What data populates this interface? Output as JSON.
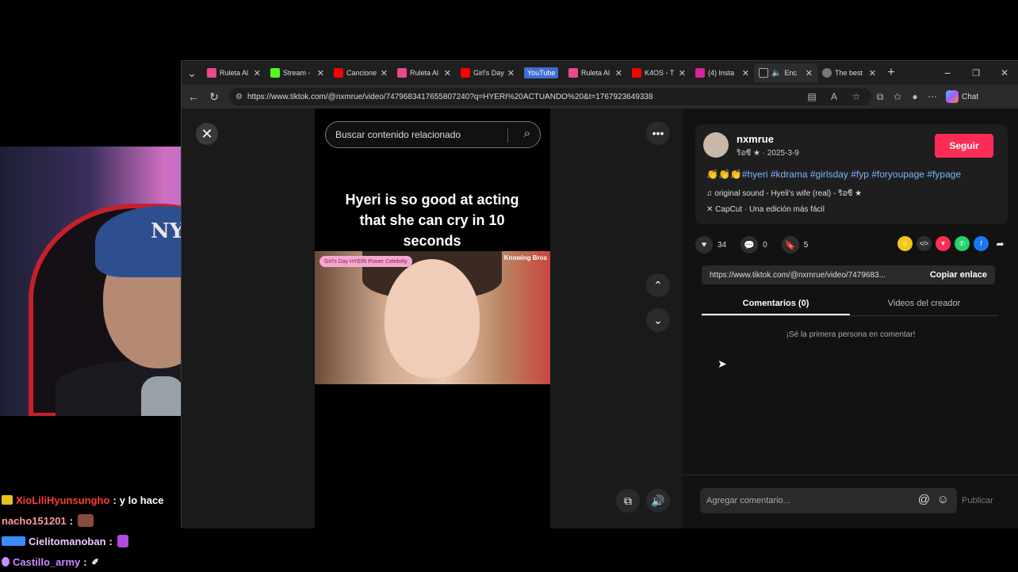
{
  "browser": {
    "tabs": [
      {
        "label": "Ruleta Al",
        "fav_color": "#e84a8f"
      },
      {
        "label": "Stream -",
        "fav_color": "#53fc18"
      },
      {
        "label": "Cancione",
        "fav_color": "#ff0000"
      },
      {
        "label": "Ruleta Al",
        "fav_color": "#e84a8f"
      },
      {
        "label": "Girl's Day",
        "fav_color": "#ff0000"
      },
      {
        "label": "YouTube",
        "fav_color": "#3d6fd1"
      },
      {
        "label": "Ruleta Al",
        "fav_color": "#e84a8f"
      },
      {
        "label": "K4OS - T",
        "fav_color": "#ff0000"
      },
      {
        "label": "(4) Insta",
        "fav_color": "#d6249f"
      },
      {
        "label": "Enc",
        "fav_color": "#222222"
      },
      {
        "label": "The best",
        "fav_color": "#777777"
      }
    ],
    "new_tab": "+",
    "window_controls": {
      "minimize": "−",
      "restore": "❐",
      "close": "✕"
    },
    "url": "https://www.tiktok.com/@nxmrue/video/7479683417655807240?q=HYERI%20ACTUANDO%20&t=1767923649338",
    "chat_label": "Chat"
  },
  "video": {
    "close": "✕",
    "search_placeholder": "Buscar contenido relacionado",
    "caption": "Hyeri is so good at acting that she can cry in 10 seconds",
    "label": "Girl's Day HYERI Power Celebrity",
    "watermark": "Knowing Bros"
  },
  "side": {
    "username": "nxmrue",
    "meta": "ริอซี ★ · 2025-3-9",
    "follow": "Seguir",
    "tags": "👏👏👏#hyeri #kdrama #girlsday #fyp #foryoupage #fypage",
    "sound": "♫  original sound - Hyeli's wife (real) - ริอซี ★",
    "capcut": "✕  CapCut · Una edición más fácil",
    "likes": "34",
    "comments": "0",
    "saves": "5",
    "link": "https://www.tiktok.com/@nxmrue/video/7479683...",
    "copy_link": "Copiar enlace",
    "tab_comments": "Comentarios (0)",
    "tab_videos": "Videos del creador",
    "empty_comments": "¡Sé la primera persona en comentar!",
    "comment_placeholder": "Agregar comentario...",
    "publish": "Publicar"
  },
  "webcam": {
    "cap_logo": "NY"
  },
  "chat": [
    {
      "user": "XioLiliHyunsungho",
      "sep": ":",
      "msg": "y lo hace",
      "color": "#ff3b3b",
      "badge_color": "#e8c020"
    },
    {
      "user": "nacho151201",
      "sep": ":",
      "msg": "",
      "color": "#ff9a9a",
      "badge_color": ""
    },
    {
      "user": "Cielitomanoban",
      "sep": ":",
      "msg": "",
      "color": "#f0c8ff",
      "badge_color": "#3b8cff"
    },
    {
      "user": "Castillo_army",
      "sep": ":",
      "msg": "",
      "color": "#c88cff",
      "badge_color": "#c88cff"
    }
  ]
}
